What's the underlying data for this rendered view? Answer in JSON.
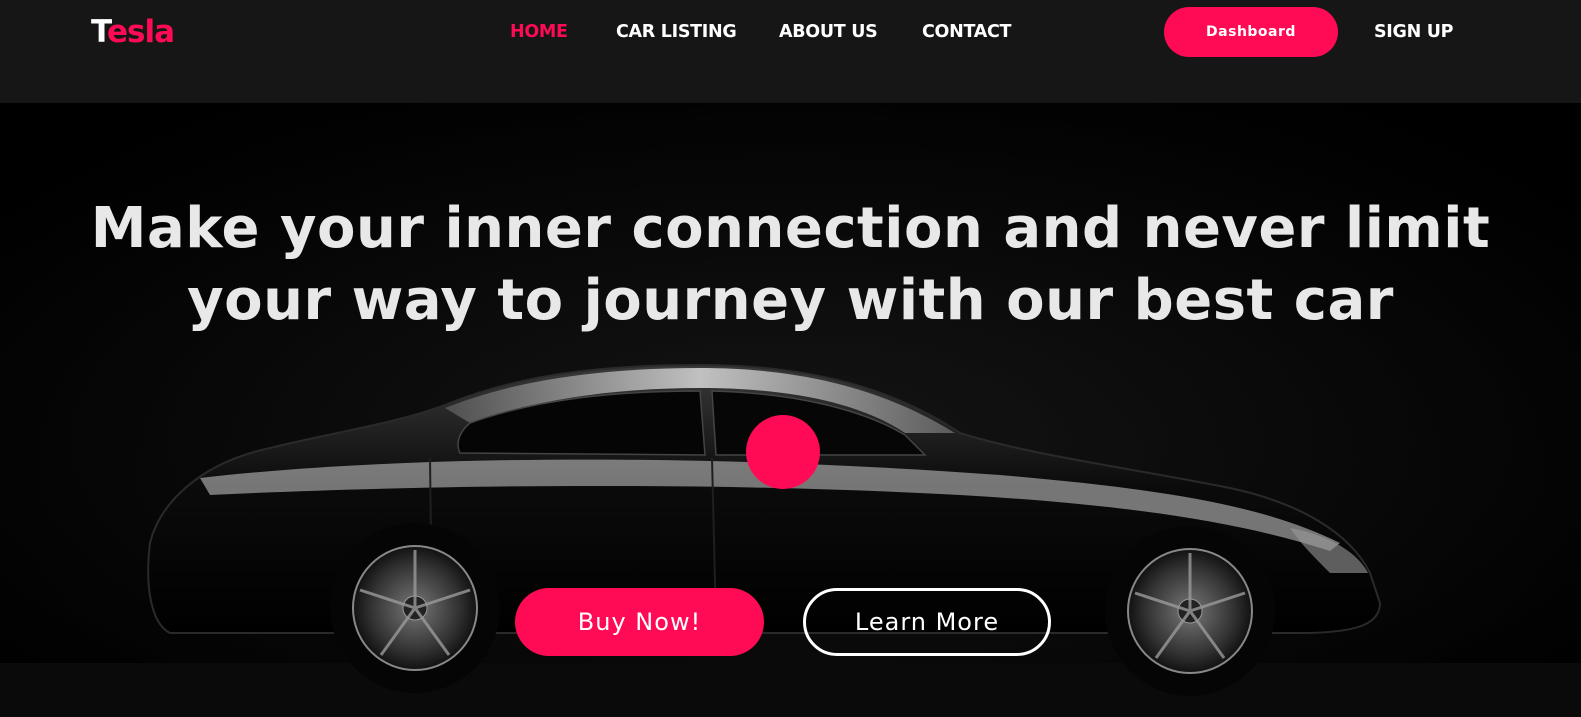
{
  "brand": {
    "first_letter": "T",
    "rest": "esla"
  },
  "nav": {
    "links": [
      {
        "label": "HOME",
        "active": true
      },
      {
        "label": "CAR LISTING",
        "active": false
      },
      {
        "label": "ABOUT US",
        "active": false
      },
      {
        "label": "CONTACT",
        "active": false
      }
    ],
    "dashboard_label": "Dashboard",
    "signup_label": "SIGN UP"
  },
  "hero": {
    "headline_line1": "Make your inner connection and never limit",
    "headline_line2": "your way to journey with our best car",
    "buy_label": "Buy Now!",
    "learn_label": "Learn More",
    "background_image": "black sedan car"
  },
  "colors": {
    "accent": "#ff0a54",
    "navbar_bg": "#161616",
    "hero_bg": "#000000",
    "text": "#ffffff"
  }
}
